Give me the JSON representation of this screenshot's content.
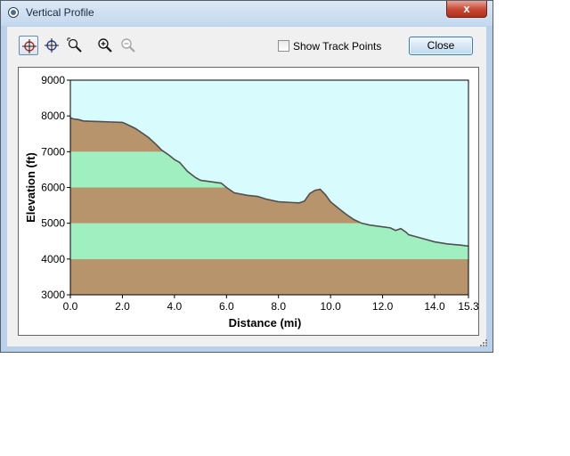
{
  "window": {
    "title": "Vertical Profile",
    "close_glyph": "x"
  },
  "toolbar": {
    "tools": [
      {
        "name": "crosshair-red-icon",
        "active": true
      },
      {
        "name": "crosshair-blue-icon",
        "active": false
      },
      {
        "name": "zoom-region-icon",
        "active": false
      },
      {
        "name": "zoom-in-icon",
        "active": false
      },
      {
        "name": "zoom-out-icon",
        "active": false
      }
    ],
    "show_track_points_label": "Show Track Points",
    "show_track_points_checked": false,
    "close_label": "Close"
  },
  "chart_data": {
    "type": "area",
    "title": "",
    "xlabel": "Distance   (mi)",
    "ylabel": "Elevation  (ft)",
    "xlim": [
      0,
      15.3
    ],
    "ylim": [
      3000,
      9000
    ],
    "xticks": [
      "0.0",
      "2.0",
      "4.0",
      "6.0",
      "8.0",
      "10.0",
      "12.0",
      "14.0",
      "15.3"
    ],
    "xtick_values": [
      0,
      2,
      4,
      6,
      8,
      10,
      12,
      14,
      15.3
    ],
    "yticks": [
      "3000",
      "4000",
      "5000",
      "6000",
      "7000",
      "8000",
      "9000"
    ],
    "ytick_values": [
      3000,
      4000,
      5000,
      6000,
      7000,
      8000,
      9000
    ],
    "bands": [
      {
        "from": 3000,
        "to": 4000,
        "color": "#b8946c"
      },
      {
        "from": 4000,
        "to": 5000,
        "color": "#a0efc0"
      },
      {
        "from": 5000,
        "to": 6000,
        "color": "#b8946c"
      },
      {
        "from": 6000,
        "to": 7000,
        "color": "#a0efc0"
      },
      {
        "from": 7000,
        "to": 8000,
        "color": "#b8946c"
      }
    ],
    "sky_color": "#d8fbfe",
    "line_color": "#505050",
    "profile": {
      "x": [
        0,
        0.1,
        0.3,
        0.5,
        0.8,
        1.2,
        1.6,
        2.0,
        2.1,
        2.5,
        3.0,
        3.3,
        3.5,
        3.8,
        4.0,
        4.2,
        4.5,
        4.8,
        5.0,
        5.5,
        5.8,
        6.0,
        6.3,
        6.8,
        7.2,
        7.5,
        8.0,
        8.5,
        8.8,
        9.0,
        9.2,
        9.4,
        9.6,
        9.8,
        10.0,
        10.3,
        10.6,
        10.9,
        11.2,
        11.5,
        12.0,
        12.3,
        12.5,
        12.7,
        12.9,
        13.0,
        13.5,
        14.0,
        14.5,
        15.0,
        15.3
      ],
      "y": [
        7950,
        7920,
        7900,
        7860,
        7850,
        7840,
        7830,
        7820,
        7790,
        7650,
        7400,
        7200,
        7050,
        6900,
        6780,
        6700,
        6450,
        6280,
        6200,
        6150,
        6120,
        6000,
        5850,
        5780,
        5750,
        5680,
        5600,
        5580,
        5570,
        5620,
        5830,
        5920,
        5950,
        5800,
        5600,
        5420,
        5250,
        5100,
        5000,
        4950,
        4900,
        4870,
        4800,
        4850,
        4750,
        4680,
        4580,
        4480,
        4420,
        4390,
        4360
      ]
    }
  }
}
